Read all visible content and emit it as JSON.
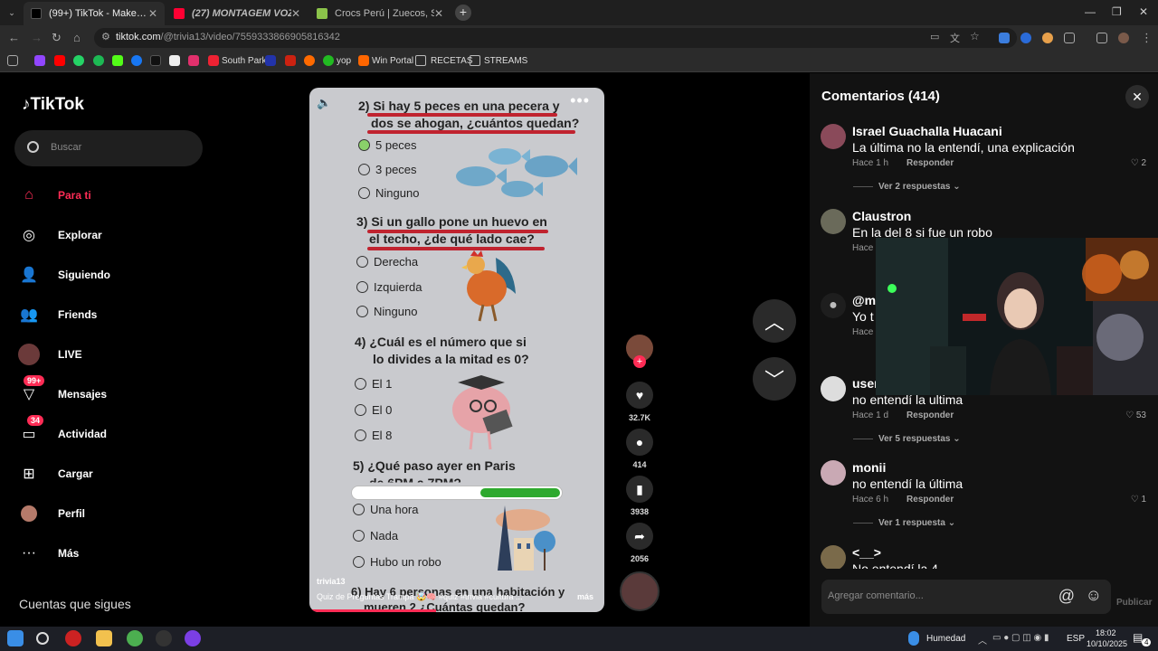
{
  "browser": {
    "tabs": [
      {
        "label": "(99+) TikTok - Make Your D...",
        "active": true
      },
      {
        "label": "(27) MONTAGEM VOZES TALE...",
        "active": false
      },
      {
        "label": "Crocs Perú | Zuecos, Sandalias...",
        "active": false
      }
    ],
    "url_host": "tiktok.com",
    "url_path": "/@trivia13/video/7559333866905816342",
    "bookmarks": [
      "South Park",
      "yop",
      "Win Portal",
      "RECETAS",
      "STREAMS"
    ]
  },
  "sidebar": {
    "logo": "TikTok",
    "search_placeholder": "Buscar",
    "items": [
      {
        "label": "Para ti",
        "active": true
      },
      {
        "label": "Explorar"
      },
      {
        "label": "Siguiendo"
      },
      {
        "label": "Friends"
      },
      {
        "label": "LIVE"
      },
      {
        "label": "Mensajes",
        "badge": "99+"
      },
      {
        "label": "Actividad",
        "badge": "34"
      },
      {
        "label": "Cargar"
      },
      {
        "label": "Perfil"
      },
      {
        "label": "Más"
      }
    ],
    "following_heading": "Cuentas que sigues"
  },
  "video": {
    "q2": "2) Si hay 5 peces en una pecera y dos se ahogan, ¿cuántos quedan?",
    "q2_l1": "2) Si hay 5 peces en una pecera y",
    "q2_l2": "dos se ahogan, ¿cuántos quedan?",
    "q2_opts": [
      "5 peces",
      "3 peces",
      "Ninguno"
    ],
    "q3_l1": "3) Si un gallo pone un huevo en",
    "q3_l2": "el techo, ¿de qué lado cae?",
    "q3_opts": [
      "Derecha",
      "Izquierda",
      "Ninguno"
    ],
    "q4_l1": "4) ¿Cuál es el número que si",
    "q4_l2": "lo divides a la mitad es 0?",
    "q4_opts": [
      "El 1",
      "El 0",
      "El 8"
    ],
    "q5_l1": "5) ¿Qué paso ayer en Paris",
    "q5_l2": "de 6PM a 7PM?",
    "q5_opts": [
      "Una hora",
      "Nada",
      "Hubo un robo"
    ],
    "q6_l1": "6) Hay 6 personas en una habitación y",
    "q6_l2": "mueren 2 ¿Cuántas quedan?",
    "progress": 0.38,
    "author": "trivia13",
    "caption": "Quiz de Preguntas Trampa 🤯🧠 #quiz #trivia #cultura ...",
    "more": "más",
    "playback_progress": 0.43
  },
  "actions": {
    "likes": "32.7K",
    "comments": "414",
    "saves": "3938",
    "shares": "2056"
  },
  "comments": {
    "title": "Comentarios (414)",
    "items": [
      {
        "name": "Israel Guachalla Huacani",
        "text": "La última no la entendí, una explicación",
        "time": "Hace 1 h",
        "reply": "Responder",
        "likes": "2",
        "replies": "Ver 2 respuestas"
      },
      {
        "name": "Claustron",
        "text": "En la del 8 si fue un robo",
        "time": "Hace",
        "reply": "",
        "likes": "",
        "replies": ""
      },
      {
        "name": "@m",
        "text": "Yo t",
        "time": "Hace",
        "reply": "",
        "likes": "",
        "replies": ""
      },
      {
        "name": "user",
        "text": "no entendí la ultima",
        "time": "Hace 1 d",
        "reply": "Responder",
        "likes": "53",
        "replies": "Ver 5 respuestas"
      },
      {
        "name": "monii",
        "text": "no entendí la última",
        "time": "Hace 6 h",
        "reply": "Responder",
        "likes": "1",
        "replies": "Ver 1 respuesta"
      },
      {
        "name": "<__>",
        "text": "No entendí la 4",
        "time": "",
        "reply": "",
        "likes": "",
        "replies": ""
      }
    ],
    "input_placeholder": "Agregar comentario...",
    "post_label": "Publicar"
  },
  "taskbar": {
    "weather": "Humedad",
    "lang": "ESP",
    "time": "18:02",
    "date": "10/10/2025",
    "notif_count": "4"
  },
  "colors": {
    "accent": "#fe2c55",
    "underline": "#c0232f",
    "progress": "#2ea92e"
  }
}
